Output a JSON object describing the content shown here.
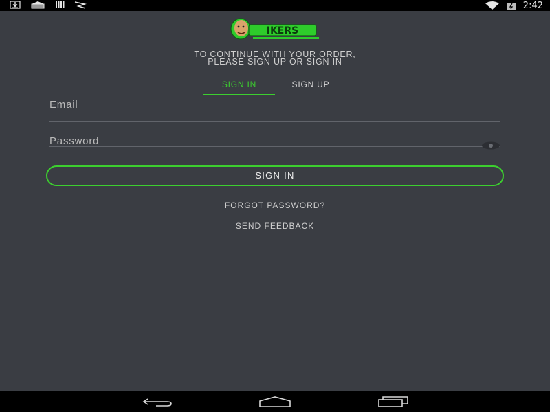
{
  "status_bar": {
    "left_icons": [
      "download-icon",
      "photo-icon",
      "barcode-icon",
      "flag-icon"
    ],
    "right_icons": [
      "wifi-icon",
      "battery-icon"
    ],
    "time": "2:42"
  },
  "logo": {
    "icon": "brand-logo-mascot",
    "text": "IKERS"
  },
  "headline": {
    "line1": "TO CONTINUE WITH YOUR ORDER,",
    "line2": "PLEASE SIGN UP OR SIGN IN"
  },
  "tabs": [
    {
      "label": "SIGN IN",
      "active": true
    },
    {
      "label": "SIGN UP",
      "active": false
    }
  ],
  "form": {
    "email_placeholder": "Email",
    "email_value": "",
    "password_placeholder": "Password",
    "password_value": "",
    "password_toggle_icon": "eye-icon"
  },
  "sign_in_button_label": "SIGN IN",
  "links": {
    "forgot_password": "FORGOT PASSWORD?",
    "send_feedback": "SEND FEEDBACK"
  },
  "nav_bar": {
    "buttons": [
      "back-icon",
      "home-icon",
      "recents-icon"
    ]
  },
  "colors": {
    "accent": "#3ccf2f",
    "background": "#3a3d43",
    "bars": "#000000"
  }
}
